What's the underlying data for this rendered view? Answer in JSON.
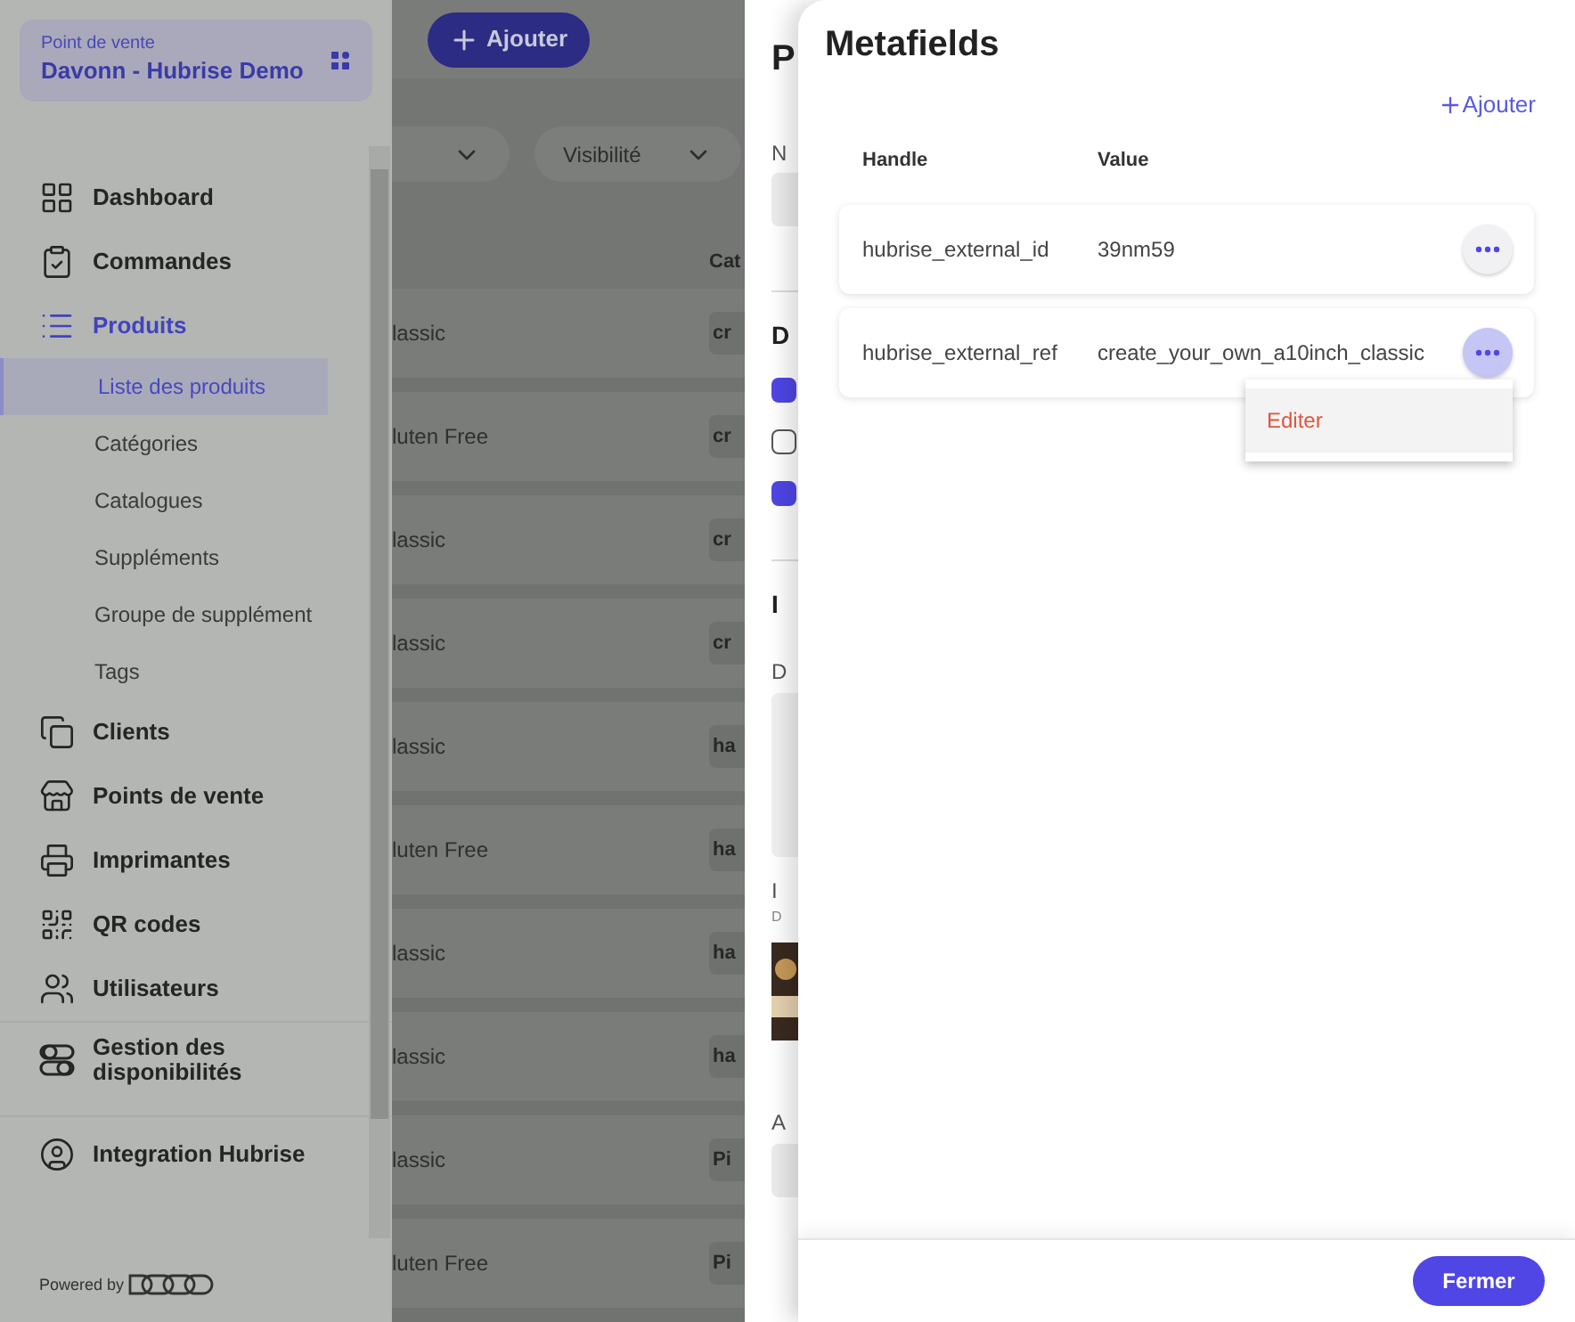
{
  "sidebar": {
    "store_card": {
      "label": "Point de vente",
      "name": "Davonn - Hubrise Demo"
    },
    "sections": [
      {
        "items": [
          {
            "label": "Dashboard",
            "selected": false
          },
          {
            "label": "Commandes",
            "selected": false
          },
          {
            "label": "Produits",
            "selected": true,
            "expanded": true,
            "children": [
              {
                "label": "Liste des produits",
                "selected": true
              },
              {
                "label": "Catégories",
                "selected": false
              },
              {
                "label": "Catalogues",
                "selected": false
              },
              {
                "label": "Suppléments",
                "selected": false
              },
              {
                "label": "Groupe de supplément",
                "selected": false
              },
              {
                "label": "Tags",
                "selected": false
              }
            ]
          },
          {
            "label": "Clients",
            "selected": false
          },
          {
            "label": "Points de vente",
            "selected": false
          },
          {
            "label": "Imprimantes",
            "selected": false
          },
          {
            "label": "QR codes",
            "selected": false
          },
          {
            "label": "Utilisateurs",
            "selected": false
          }
        ]
      },
      {
        "items": [
          {
            "label": "Gestion des disponibilités",
            "selected": false
          }
        ]
      },
      {
        "items": [
          {
            "label": "Integration Hubrise",
            "selected": false
          }
        ]
      }
    ],
    "powered_by": "Powered by"
  },
  "main": {
    "add_button": "Ajouter",
    "filters": [
      {
        "kind": "cut"
      },
      {
        "kind": "full",
        "label": "Visibilité"
      }
    ],
    "column_header": "Cat",
    "rows": [
      {
        "name": "lassic",
        "category": "cr"
      },
      {
        "name": "luten Free",
        "category": "cr"
      },
      {
        "name": "lassic",
        "category": "cr"
      },
      {
        "name": "lassic",
        "category": "cr"
      },
      {
        "name": "lassic",
        "category": "ha"
      },
      {
        "name": "luten Free",
        "category": "ha"
      },
      {
        "name": "lassic",
        "category": "ha"
      },
      {
        "name": "lassic",
        "category": "ha"
      },
      {
        "name": "lassic",
        "category": "Pi"
      },
      {
        "name": "luten Free",
        "category": "Pi"
      }
    ]
  },
  "drawer_behind": {
    "title": "P",
    "name_label": "N",
    "section_1": "D",
    "checkboxes": [
      {
        "checked": true
      },
      {
        "checked": false
      },
      {
        "checked": true
      }
    ],
    "section_2": "I",
    "description_label": "D",
    "image_label": "I",
    "image_hint": "D",
    "last_label": "A"
  },
  "metafields": {
    "title": "Metafields",
    "add_button": "Ajouter",
    "columns": [
      "Handle",
      "Value"
    ],
    "rows": [
      {
        "handle": "hubrise_external_id",
        "value": "39nm59",
        "menu_open": false
      },
      {
        "handle": "hubrise_external_ref",
        "value": "create_your_own_a10inch_classic",
        "menu_open": true
      }
    ],
    "menu": {
      "items": [
        "Editer"
      ]
    },
    "close_button": "Fermer"
  }
}
